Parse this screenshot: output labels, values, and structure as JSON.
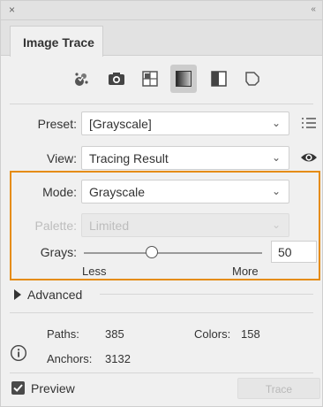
{
  "titlebar": {
    "close_glyph": "×",
    "collapse_glyph": "‹‹"
  },
  "panel": {
    "tab_label": "Image Trace"
  },
  "presets_icons": [
    {
      "name": "auto-color-icon"
    },
    {
      "name": "high-color-icon"
    },
    {
      "name": "low-color-icon"
    },
    {
      "name": "grayscale-icon",
      "active": true
    },
    {
      "name": "black-and-white-icon"
    },
    {
      "name": "outline-icon"
    }
  ],
  "preset": {
    "label": "Preset:",
    "value": "[Grayscale]"
  },
  "view": {
    "label": "View:",
    "value": "Tracing Result"
  },
  "mode": {
    "label": "Mode:",
    "value": "Grayscale"
  },
  "palette": {
    "label": "Palette:",
    "value": "Limited"
  },
  "grays": {
    "label": "Grays:",
    "value": "50",
    "level_percent": 38,
    "min_label": "Less",
    "max_label": "More"
  },
  "advanced": {
    "label": "Advanced"
  },
  "stats": {
    "paths_label": "Paths:",
    "paths_value": "385",
    "colors_label": "Colors:",
    "colors_value": "158",
    "anchors_label": "Anchors:",
    "anchors_value": "3132"
  },
  "preview": {
    "label": "Preview",
    "checked": true
  },
  "trace_button": {
    "label": "Trace"
  },
  "colors": {
    "highlight": "#e58c12",
    "panel_bg": "#f0f0f0"
  }
}
